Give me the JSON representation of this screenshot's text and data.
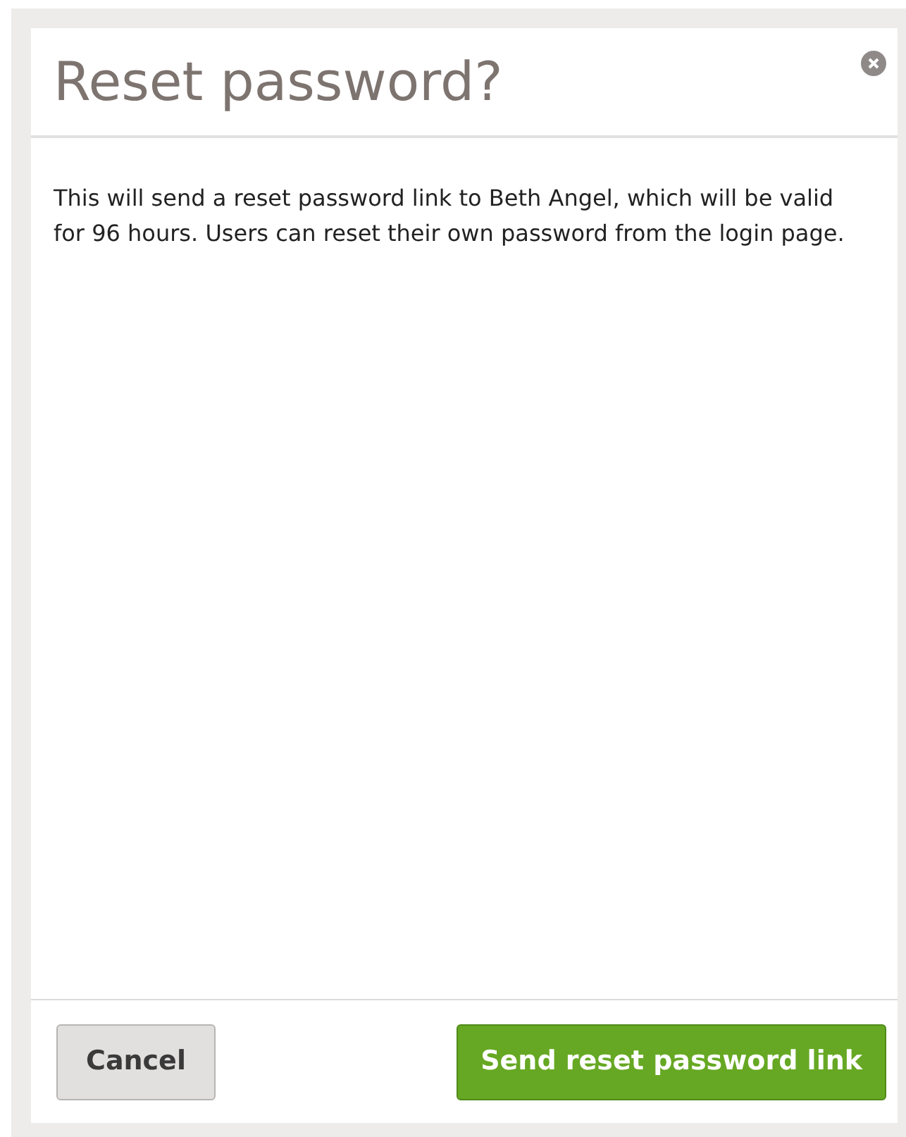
{
  "dialog": {
    "title": "Reset password?",
    "message": "This will send a reset password link to Beth Angel, which will be valid for 96 hours. Users can reset their own password from the login page.",
    "buttons": [
      {
        "label": "Cancel",
        "kind": "secondary"
      },
      {
        "label": "Send reset password link",
        "kind": "primary"
      }
    ]
  }
}
